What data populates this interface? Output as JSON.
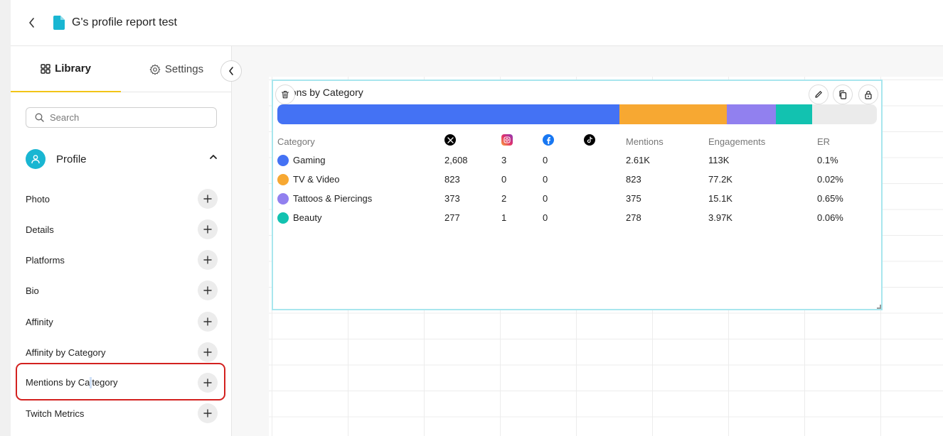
{
  "header": {
    "title": "G's profile report test"
  },
  "sidebar": {
    "tabs": [
      {
        "label": "Library"
      },
      {
        "label": "Settings"
      }
    ],
    "search": {
      "placeholder": "Search",
      "value": ""
    },
    "section": {
      "label": "Profile"
    },
    "items": [
      {
        "label": "Photo"
      },
      {
        "label": "Details"
      },
      {
        "label": "Platforms"
      },
      {
        "label": "Bio"
      },
      {
        "label": "Affinity"
      },
      {
        "label": "Affinity by Category"
      },
      {
        "label_a": "Mentions by Ca",
        "label_b": "tegory"
      },
      {
        "label": "Twitch Metrics"
      }
    ]
  },
  "widget": {
    "title": "ntions by Category",
    "columns": [
      "Category",
      "",
      "",
      "",
      "",
      "Mentions",
      "Engagements",
      "ER"
    ],
    "platform_icons": [
      "x-icon",
      "instagram-icon",
      "facebook-icon",
      "tiktok-icon"
    ],
    "rows": [
      {
        "category": "Gaming",
        "color": "#4472f4",
        "x": "2,608",
        "instagram": "3",
        "facebook": "0",
        "tiktok": "",
        "mentions": "2.61K",
        "engagements": "113K",
        "er": "0.1%"
      },
      {
        "category": "TV & Video",
        "color": "#f7a832",
        "x": "823",
        "instagram": "0",
        "facebook": "0",
        "tiktok": "",
        "mentions": "823",
        "engagements": "77.2K",
        "er": "0.02%"
      },
      {
        "category": "Tattoos & Piercings",
        "color": "#9180ef",
        "x": "373",
        "instagram": "2",
        "facebook": "0",
        "tiktok": "",
        "mentions": "375",
        "engagements": "15.1K",
        "er": "0.65%"
      },
      {
        "category": "Beauty",
        "color": "#12c2b0",
        "x": "277",
        "instagram": "1",
        "facebook": "0",
        "tiktok": "",
        "mentions": "278",
        "engagements": "3.97K",
        "er": "0.06%"
      }
    ],
    "bar_remainder_color": "#ebebeb"
  },
  "colors": {
    "accent_tab": "#f2c417",
    "highlight": "#d3211f",
    "widget_border": "#a8e6ee",
    "avatar": "#19b6d2"
  }
}
